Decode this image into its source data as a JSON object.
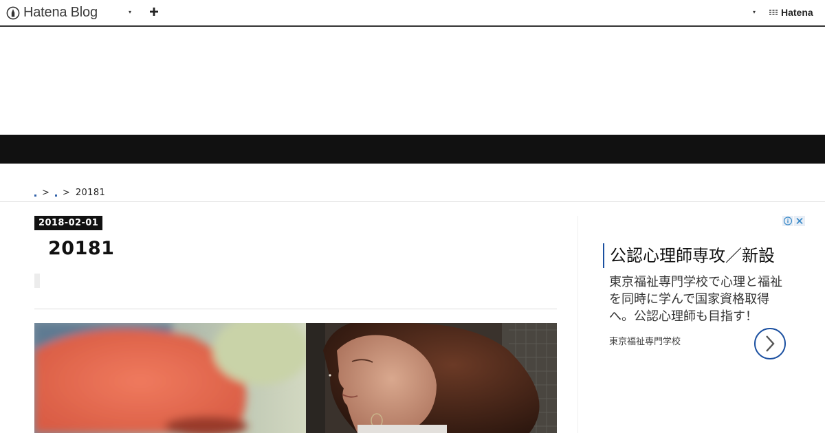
{
  "header": {
    "logo_text": "Hatena Blog",
    "menu_caret": "▾",
    "add_icon": "plus-icon",
    "right_caret": "▾",
    "hatena_text": "Hatena"
  },
  "breadcrumb": {
    "separator": ">",
    "current": "20181"
  },
  "entry": {
    "date": "2018-02-01",
    "title": "20181"
  },
  "ad": {
    "headline": "公認心理師専攻／新設",
    "body": "東京福祉専門学校で心理と福祉を同時に学んで国家資格取得へ。公認心理師も目指す！",
    "advertiser": "東京福祉専門学校",
    "info_icon": "info-icon",
    "close_icon": "close-icon",
    "arrow_icon": "chevron-right-icon"
  },
  "colors": {
    "band": "#111111",
    "accent_blue": "#1a4fa0",
    "header_rule": "#333333"
  }
}
